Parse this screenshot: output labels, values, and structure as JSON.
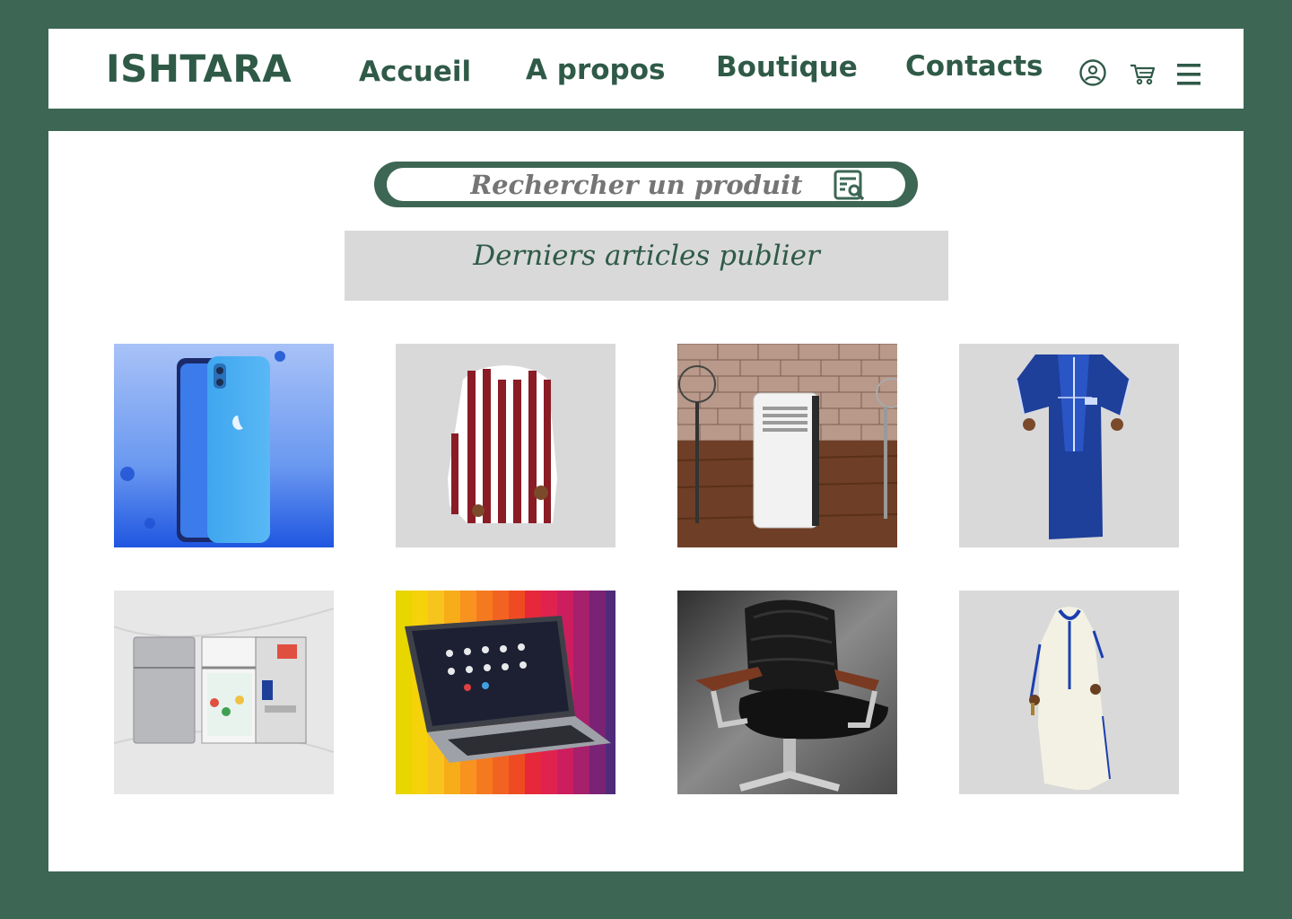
{
  "header": {
    "logo": "ISHTARA",
    "nav": [
      {
        "label": "Accueil"
      },
      {
        "label": "A propos"
      },
      {
        "label": "Boutique"
      },
      {
        "label": "Contacts"
      }
    ],
    "icons": [
      "user-account-icon",
      "cart-icon",
      "hamburger-menu-icon"
    ]
  },
  "search": {
    "placeholder": "Rechercher un produit",
    "icon": "search-document-icon"
  },
  "section": {
    "title": "Derniers articles publier"
  },
  "products": [
    {
      "image": "blue-smartphone"
    },
    {
      "image": "striped-red-djellaba"
    },
    {
      "image": "portable-air-conditioner"
    },
    {
      "image": "blue-kaftan"
    },
    {
      "image": "mini-refrigerator"
    },
    {
      "image": "laptop"
    },
    {
      "image": "black-office-chair"
    },
    {
      "image": "white-djellaba"
    }
  ],
  "colors": {
    "brand_green": "#3d6655",
    "text_green": "#2f5a48",
    "panel_gray": "#d9d9d9",
    "white": "#ffffff"
  }
}
